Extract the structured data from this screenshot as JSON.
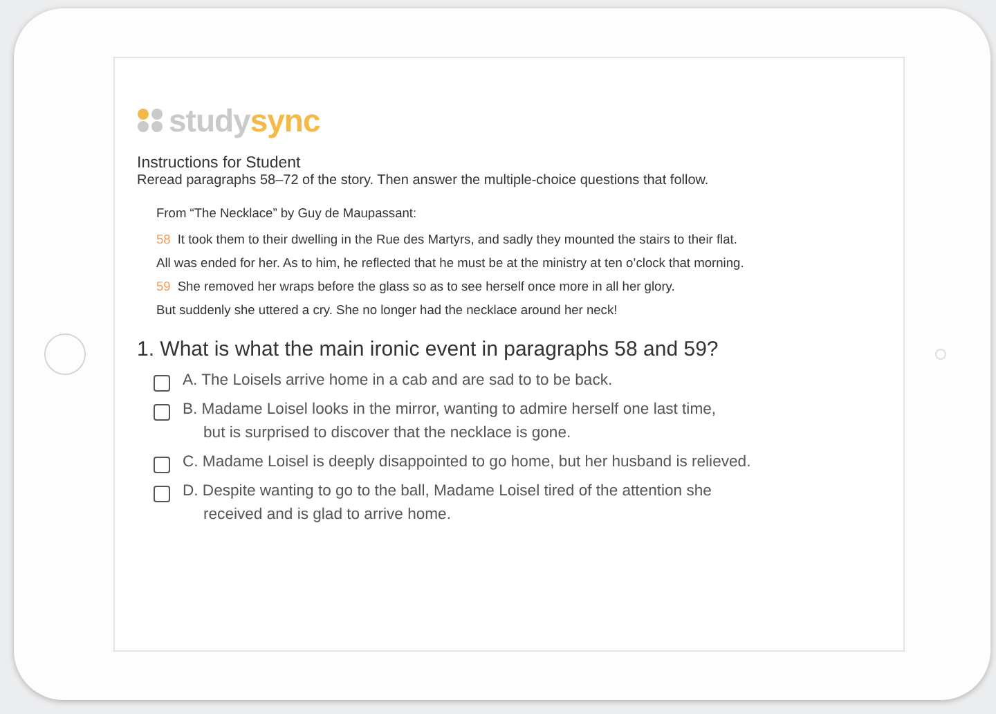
{
  "logo": {
    "part_1": "study",
    "part_2": "sync"
  },
  "instructions": {
    "title": "Instructions for Student",
    "text": "Reread paragraphs 58–72 of the story. Then answer the multiple-choice questions that follow."
  },
  "excerpt": {
    "source": "From “The Necklace” by Guy de Maupassant:",
    "paragraphs": [
      {
        "number": "58",
        "lines": [
          "It took them to their dwelling in the Rue des Martyrs, and sadly they mounted the stairs to their flat.",
          "All was ended for her. As to him, he reflected that he must be at the ministry at ten o’clock that morning."
        ]
      },
      {
        "number": "59",
        "lines": [
          "She removed her wraps before the glass so as to see herself once more in all her glory.",
          "But suddenly she uttered a cry. She no longer had the necklace around her neck!"
        ]
      }
    ]
  },
  "question": {
    "text": "1. What is what the main ironic event in paragraphs 58 and 59?",
    "options": [
      {
        "lines": [
          "A. The Loisels arrive home in a cab and are sad to to be back."
        ],
        "checked": false
      },
      {
        "lines": [
          "B. Madame Loisel looks in the mirror, wanting to admire herself one last time,",
          "but is surprised to discover that the necklace is gone."
        ],
        "checked": false
      },
      {
        "lines": [
          "C. Madame Loisel is deeply disappointed to go home, but her husband is relieved."
        ],
        "checked": false
      },
      {
        "lines": [
          "D. Despite wanting to go to the ball, Madame Loisel tired of the attention she",
          "received and is glad to arrive home."
        ],
        "checked": false
      }
    ]
  }
}
